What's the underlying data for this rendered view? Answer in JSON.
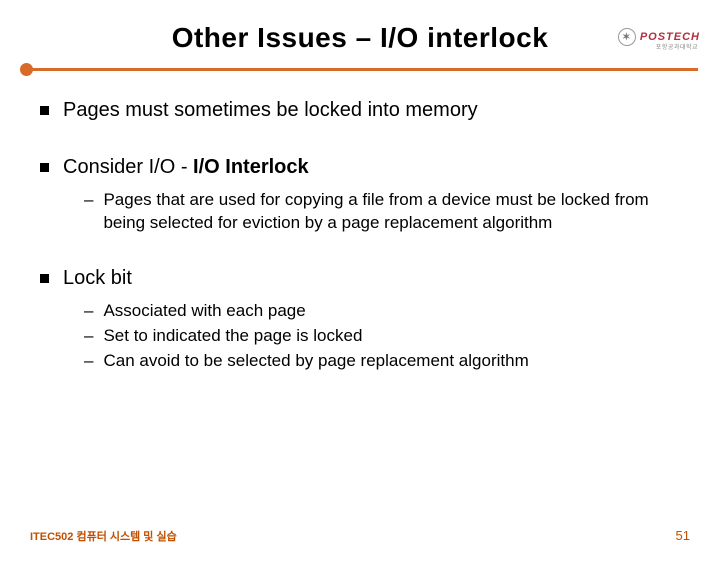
{
  "logo": {
    "text": "POSTECH",
    "symbol": "✶",
    "sub": "포항공과대학교"
  },
  "title": "Other Issues – I/O interlock",
  "bullets": {
    "b1": {
      "text": "Pages must sometimes be locked into memory"
    },
    "b2": {
      "prefix": "Consider I/O - ",
      "bold": "I/O Interlock",
      "sub1": "Pages that are used for copying a file from a device must be locked from being selected for eviction by a page replacement algorithm"
    },
    "b3": {
      "text": "Lock bit",
      "sub1": "Associated with each page",
      "sub2": "Set to indicated the page is locked",
      "sub3": "Can avoid to be selected by page replacement algorithm"
    }
  },
  "footer": {
    "left": "ITEC502 컴퓨터 시스템 및 실습",
    "right": "51"
  }
}
